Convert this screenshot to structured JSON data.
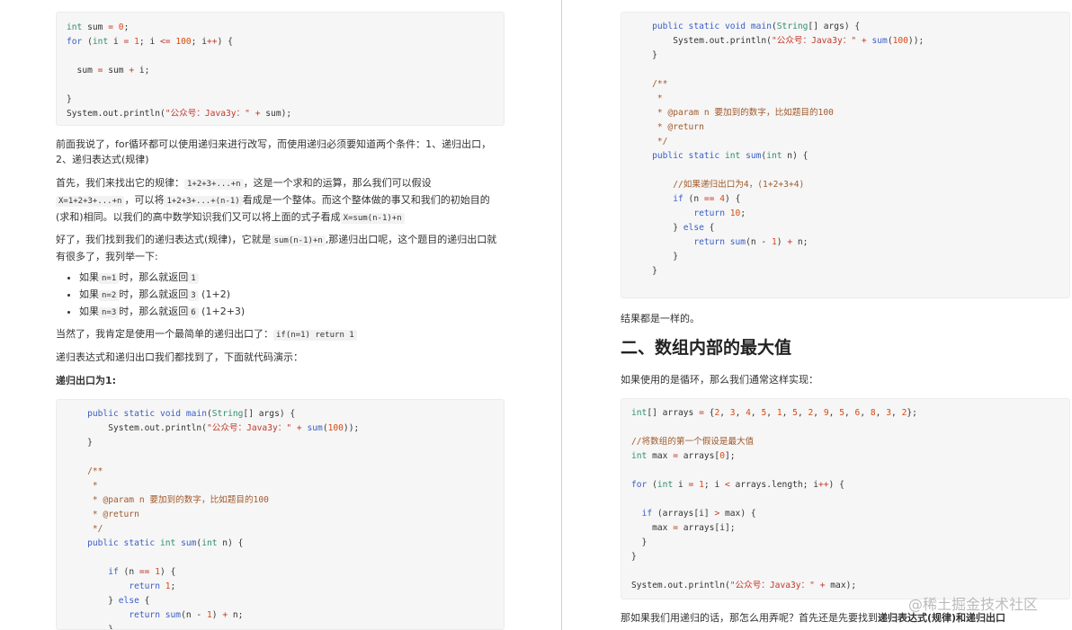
{
  "left": {
    "code1": "int sum = 0;\nfor (int i = 1; i <= 100; i++) {\n\n  sum = sum + i;\n\n}\nSystem.out.println(\"公众号：Java3y：\" + sum);",
    "p1": "前面我说了，for循环都可以使用递归来进行改写，而使用递归必须要知道两个条件：1、递归出口，2、递归表达式(规律)",
    "p2_a": "首先，我们来找出它的规律：",
    "p2_c1": "1+2+3+...+n",
    "p2_b": "，这是一个求和的运算，那么我们可以假设",
    "p2_c2": "X=1+2+3+...+n",
    "p2_c": "，可以将",
    "p2_c3": "1+2+3+...+(n-1)",
    "p2_d": "看成是一个整体。而这个整体做的事又和我们的初始目的(求和)相同。以我们的高中数学知识我们又可以将上面的式子看成",
    "p2_c4": "X=sum(n-1)+n",
    "p3_a": "好了，我们找到我们的递归表达式(规律)，它就是",
    "p3_c1": "sum(n-1)+n",
    "p3_b": ",那递归出口呢，这个题目的递归出口就有很多了，我列举一下:",
    "list": [
      {
        "pre": "如果",
        "c1": "n=1",
        "mid": "时，那么就返回",
        "c2": "1",
        "post": ""
      },
      {
        "pre": "如果",
        "c1": "n=2",
        "mid": "时，那么就返回",
        "c2": "3",
        "post": " (1+2)"
      },
      {
        "pre": "如果",
        "c1": "n=3",
        "mid": "时，那么就返回",
        "c2": "6",
        "post": " (1+2+3)"
      }
    ],
    "p4_a": "当然了，我肯定是使用一个最简单的递归出口了：",
    "p4_c1": "if(n=1) return 1",
    "p5": "递归表达式和递归出口我们都找到了，下面就代码演示：",
    "p6": "递归出口为1:",
    "code2": "    public static void main(String[] args) {\n        System.out.println(\"公众号：Java3y：\" + sum(100));\n    }\n\n    /**\n     *\n     * @param n 要加到的数字，比如题目的100\n     * @return\n     */\n    public static int sum(int n) {\n\n        if (n == 1) {\n            return 1;\n        } else {\n            return sum(n - 1) + n;\n        }"
  },
  "right": {
    "code1": "    public static void main(String[] args) {\n        System.out.println(\"公众号：Java3y：\" + sum(100));\n    }\n\n    /**\n     *\n     * @param n 要加到的数字，比如题目的100\n     * @return\n     */\n    public static int sum(int n) {\n\n        //如果递归出口为4，(1+2+3+4)\n        if (n == 4) {\n            return 10;\n        } else {\n            return sum(n - 1) + n;\n        }\n    }",
    "p1": "结果都是一样的。",
    "h2": "二、数组内部的最大值",
    "p2": "如果使用的是循环，那么我们通常这样实现：",
    "code2": "int[] arrays = {2, 3, 4, 5, 1, 5, 2, 9, 5, 6, 8, 3, 2};\n\n//将数组的第一个假设是最大值\nint max = arrays[0];\n\nfor (int i = 1; i < arrays.length; i++) {\n\n  if (arrays[i] > max) {\n    max = arrays[i];\n  }\n}\n\nSystem.out.println(\"公众号：Java3y：\" + max);",
    "p3_a": "那如果我们用递归的话，那怎么用弄呢？首先还是先要找到",
    "p3_b": "递归表达式(规律)和递归出口"
  },
  "watermark": "@稀土掘金技术社区"
}
